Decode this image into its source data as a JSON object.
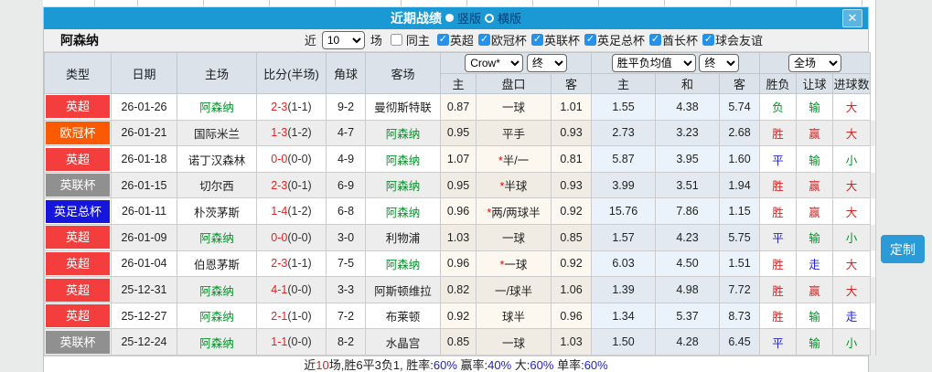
{
  "dialog": {
    "title": "近期战绩",
    "view_vertical": "竖版",
    "view_horizontal": "横版",
    "close_label": "✕"
  },
  "filter": {
    "team": "阿森纳",
    "recent_prefix": "近",
    "recent_count": "10",
    "recent_suffix": "场",
    "same_home_label": "同主",
    "leagues": [
      {
        "label": "英超",
        "checked": true
      },
      {
        "label": "欧冠杯",
        "checked": true
      },
      {
        "label": "英联杯",
        "checked": true
      },
      {
        "label": "英足总杯",
        "checked": true
      },
      {
        "label": "酋长杯",
        "checked": true
      },
      {
        "label": "球会友谊",
        "checked": true
      }
    ]
  },
  "table": {
    "selects": {
      "company": "Crow*",
      "company_state": "终",
      "avg": "胜平负均值",
      "avg_state": "终",
      "scope": "全场"
    },
    "col_headers": {
      "type": "类型",
      "date": "日期",
      "home": "主场",
      "score": "比分(半场)",
      "corner": "角球",
      "away": "客场",
      "odds_home": "主",
      "handicap": "盘口",
      "odds_away": "客",
      "avg_home": "主",
      "avg_draw": "和",
      "avg_away": "客",
      "result": "胜负",
      "let_result": "让球",
      "goals": "进球数"
    },
    "rows": [
      {
        "league": "英超",
        "league_color": "red",
        "date": "26-01-26",
        "home": "阿森纳",
        "home_color": "green",
        "score": "2-3",
        "half": "(1-1)",
        "corners": "9-2",
        "away": "曼彻斯特联",
        "away_color": "dark",
        "odds_home": "0.87",
        "star": "",
        "handicap": "一球",
        "odds_away": "1.01",
        "avg_home": "1.55",
        "avg_draw": "4.38",
        "avg_away": "5.74",
        "result": "负",
        "result_color": "green",
        "let_result": "输",
        "let_color": "green",
        "goals": "大",
        "goals_color": "red"
      },
      {
        "league": "欧冠杯",
        "league_color": "orange",
        "date": "26-01-21",
        "home": "国际米兰",
        "home_color": "dark",
        "score": "1-3",
        "half": "(1-2)",
        "corners": "4-7",
        "away": "阿森纳",
        "away_color": "green",
        "odds_home": "0.95",
        "star": "",
        "handicap": "平手",
        "odds_away": "0.93",
        "avg_home": "2.73",
        "avg_draw": "3.23",
        "avg_away": "2.68",
        "result": "胜",
        "result_color": "red",
        "let_result": "赢",
        "let_color": "red",
        "goals": "大",
        "goals_color": "red"
      },
      {
        "league": "英超",
        "league_color": "red",
        "date": "26-01-18",
        "home": "诺丁汉森林",
        "home_color": "dark",
        "score": "0-0",
        "half": "(0-0)",
        "corners": "4-9",
        "away": "阿森纳",
        "away_color": "green",
        "odds_home": "1.07",
        "star": "*",
        "handicap": "半/一",
        "odds_away": "0.81",
        "avg_home": "5.87",
        "avg_draw": "3.95",
        "avg_away": "1.60",
        "result": "平",
        "result_color": "blue",
        "let_result": "输",
        "let_color": "green",
        "goals": "小",
        "goals_color": "green"
      },
      {
        "league": "英联杯",
        "league_color": "gray",
        "date": "26-01-15",
        "home": "切尔西",
        "home_color": "dark",
        "score": "2-3",
        "half": "(0-1)",
        "corners": "6-9",
        "away": "阿森纳",
        "away_color": "green",
        "odds_home": "0.95",
        "star": "*",
        "handicap": "半球",
        "odds_away": "0.93",
        "avg_home": "3.99",
        "avg_draw": "3.51",
        "avg_away": "1.94",
        "result": "胜",
        "result_color": "red",
        "let_result": "赢",
        "let_color": "red",
        "goals": "大",
        "goals_color": "red"
      },
      {
        "league": "英足总杯",
        "league_color": "blue",
        "date": "26-01-11",
        "home": "朴茨茅斯",
        "home_color": "dark",
        "score": "1-4",
        "half": "(1-2)",
        "corners": "6-8",
        "away": "阿森纳",
        "away_color": "green",
        "odds_home": "0.96",
        "star": "*",
        "handicap": "两/两球半",
        "odds_away": "0.92",
        "avg_home": "15.76",
        "avg_draw": "7.86",
        "avg_away": "1.15",
        "result": "胜",
        "result_color": "red",
        "let_result": "赢",
        "let_color": "red",
        "goals": "大",
        "goals_color": "red"
      },
      {
        "league": "英超",
        "league_color": "red",
        "date": "26-01-09",
        "home": "阿森纳",
        "home_color": "green",
        "score": "0-0",
        "half": "(0-0)",
        "corners": "3-0",
        "away": "利物浦",
        "away_color": "dark",
        "odds_home": "1.03",
        "star": "",
        "handicap": "一球",
        "odds_away": "0.85",
        "avg_home": "1.57",
        "avg_draw": "4.23",
        "avg_away": "5.75",
        "result": "平",
        "result_color": "blue",
        "let_result": "输",
        "let_color": "green",
        "goals": "小",
        "goals_color": "green"
      },
      {
        "league": "英超",
        "league_color": "red",
        "date": "26-01-04",
        "home": "伯恩茅斯",
        "home_color": "dark",
        "score": "2-3",
        "half": "(1-1)",
        "corners": "7-5",
        "away": "阿森纳",
        "away_color": "green",
        "odds_home": "0.96",
        "star": "*",
        "handicap": "一球",
        "odds_away": "0.92",
        "avg_home": "6.03",
        "avg_draw": "4.50",
        "avg_away": "1.51",
        "result": "胜",
        "result_color": "red",
        "let_result": "走",
        "let_color": "blue",
        "goals": "大",
        "goals_color": "red"
      },
      {
        "league": "英超",
        "league_color": "red",
        "date": "25-12-31",
        "home": "阿森纳",
        "home_color": "green",
        "score": "4-1",
        "half": "(0-0)",
        "corners": "3-3",
        "away": "阿斯顿维拉",
        "away_color": "dark",
        "odds_home": "0.82",
        "star": "",
        "handicap": "一/球半",
        "odds_away": "1.06",
        "avg_home": "1.39",
        "avg_draw": "4.98",
        "avg_away": "7.72",
        "result": "胜",
        "result_color": "red",
        "let_result": "赢",
        "let_color": "red",
        "goals": "大",
        "goals_color": "red"
      },
      {
        "league": "英超",
        "league_color": "red",
        "date": "25-12-27",
        "home": "阿森纳",
        "home_color": "green",
        "score": "2-1",
        "half": "(1-0)",
        "corners": "7-2",
        "away": "布莱顿",
        "away_color": "dark",
        "odds_home": "0.92",
        "star": "",
        "handicap": "球半",
        "odds_away": "0.96",
        "avg_home": "1.34",
        "avg_draw": "5.37",
        "avg_away": "8.73",
        "result": "胜",
        "result_color": "red",
        "let_result": "输",
        "let_color": "green",
        "goals": "走",
        "goals_color": "blue"
      },
      {
        "league": "英联杯",
        "league_color": "gray",
        "date": "25-12-24",
        "home": "阿森纳",
        "home_color": "green",
        "score": "1-1",
        "half": "(0-0)",
        "corners": "8-2",
        "away": "水晶宫",
        "away_color": "dark",
        "odds_home": "0.85",
        "star": "",
        "handicap": "一球",
        "odds_away": "1.03",
        "avg_home": "1.50",
        "avg_draw": "4.28",
        "avg_away": "6.45",
        "result": "平",
        "result_color": "blue",
        "let_result": "输",
        "let_color": "green",
        "goals": "小",
        "goals_color": "green"
      }
    ]
  },
  "summary": {
    "segments": [
      {
        "t": "近",
        "c": "dark"
      },
      {
        "t": "10",
        "c": "red"
      },
      {
        "t": "场,胜6平3负1, 胜率:",
        "c": "dark"
      },
      {
        "t": "60%",
        "c": "blue"
      },
      {
        "t": " 赢率:",
        "c": "dark"
      },
      {
        "t": "40%",
        "c": "blue"
      },
      {
        "t": " 大:",
        "c": "dark"
      },
      {
        "t": "60%",
        "c": "blue"
      },
      {
        "t": " 单率:",
        "c": "dark"
      },
      {
        "t": "60%",
        "c": "blue"
      }
    ]
  },
  "customize_button": "定制"
}
